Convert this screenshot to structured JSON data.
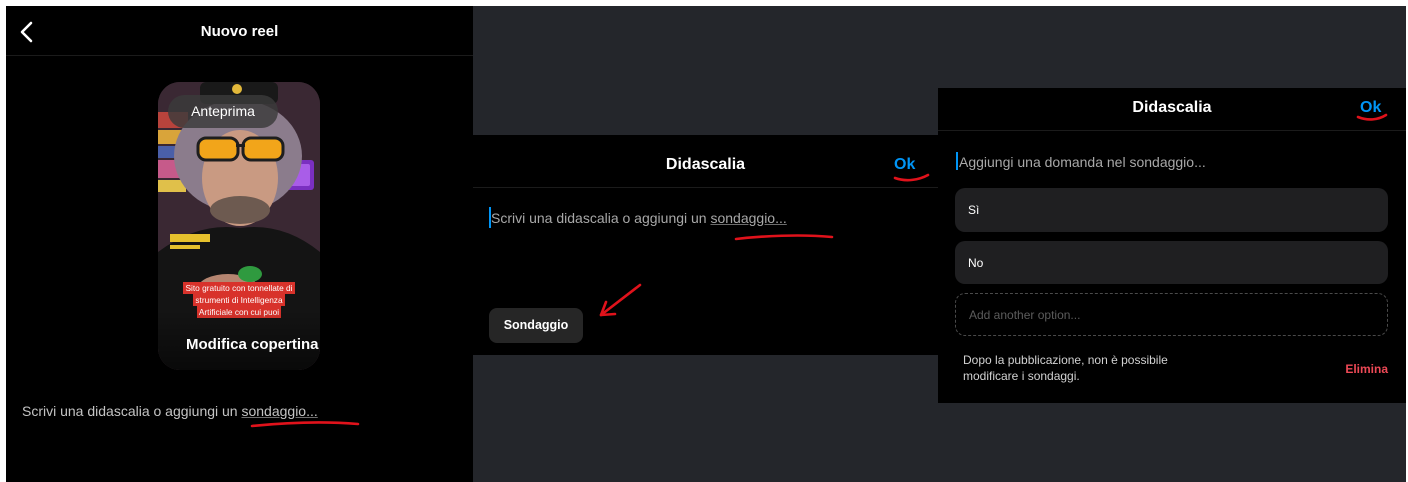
{
  "colors": {
    "accent": "#0095f6",
    "danger": "#ed4956",
    "annotation": "#e0121b",
    "backdrop": "#24262b",
    "panel": "#000000",
    "chip": "#262626"
  },
  "icons": {
    "back": "chevron-left-icon",
    "annotation_arrow": "arrow-icon"
  },
  "left": {
    "title": "Nuovo reel",
    "preview": {
      "badge": "Anteprima",
      "overlay_lines": [
        "Sito gratuito con tonnellate di",
        "strumenti di Intelligenza",
        "Artificiale con cui puoi"
      ],
      "edit_cover": "Modifica copertina"
    },
    "caption_prefix": "Scrivi una didascalia o aggiungi un ",
    "caption_link": "sondaggio..."
  },
  "middle": {
    "title": "Didascalia",
    "ok": "Ok",
    "placeholder_prefix": "Scrivi una didascalia o aggiungi un ",
    "placeholder_link": "sondaggio...",
    "poll_button": "Sondaggio"
  },
  "right": {
    "title": "Didascalia",
    "ok": "Ok",
    "question_placeholder": "Aggiungi una domanda nel sondaggio...",
    "options": [
      "Sì",
      "No"
    ],
    "add_option_placeholder": "Add another option...",
    "notice": "Dopo la pubblicazione, non è possibile modificare i sondaggi.",
    "delete": "Elimina"
  }
}
